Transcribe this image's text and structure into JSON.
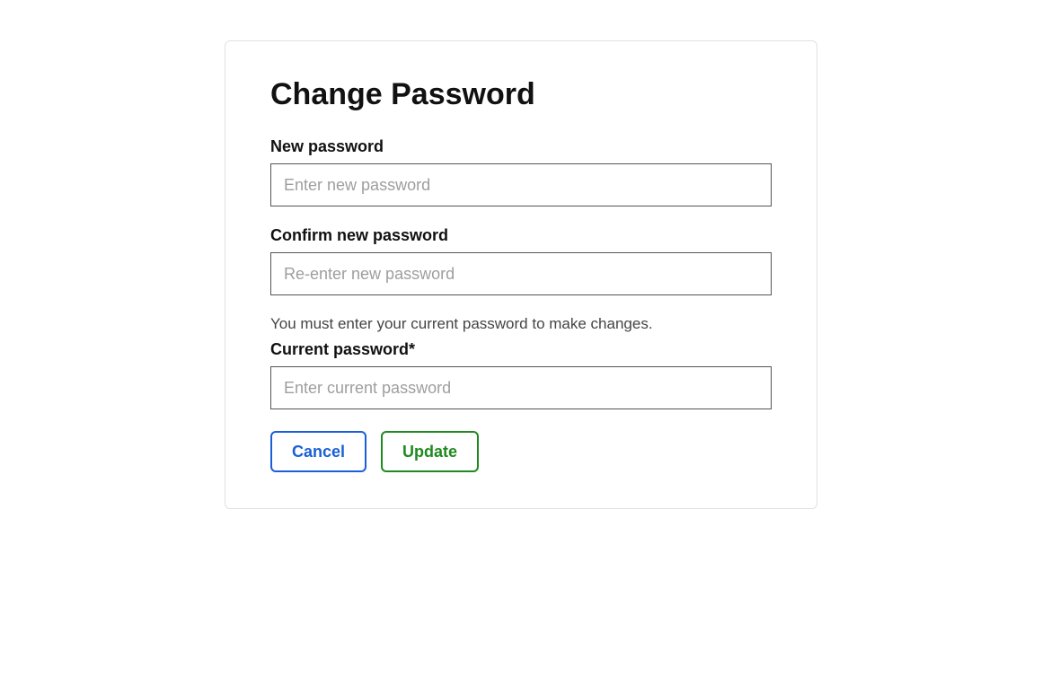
{
  "title": "Change Password",
  "fields": {
    "new_password": {
      "label": "New password",
      "placeholder": "Enter new password",
      "value": ""
    },
    "confirm_password": {
      "label": "Confirm new password",
      "placeholder": "Re-enter new password",
      "value": ""
    },
    "current_password": {
      "helper": "You must enter your current password to make changes.",
      "label": "Current password*",
      "placeholder": "Enter current password",
      "value": ""
    }
  },
  "buttons": {
    "cancel": "Cancel",
    "update": "Update"
  }
}
